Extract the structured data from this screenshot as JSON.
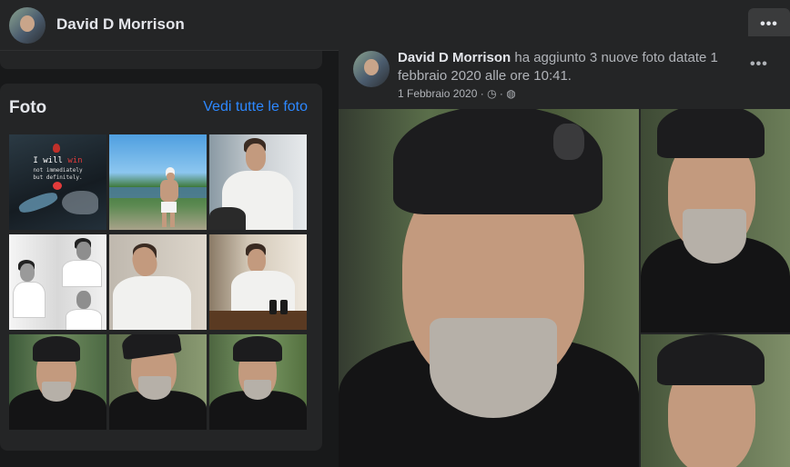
{
  "header": {
    "name": "David D Morrison",
    "more_label": "•••"
  },
  "photos": {
    "title": "Foto",
    "see_all": "Vedi tutte le foto",
    "quote_line1": "I will ",
    "quote_win": "win",
    "quote_line2": "not immediately",
    "quote_line3": "but definitely."
  },
  "post": {
    "author": "David D Morrison",
    "action": " ha aggiunto 3 nuove foto datate 1 febbraio 2020 alle ore 10:41.",
    "date": "1 Febbraio 2020",
    "meta_separator": " · ",
    "more_label": "•••"
  },
  "colors": {
    "background": "#18191a",
    "card": "#242526",
    "link": "#2d88ff",
    "text": "#e4e6eb",
    "secondary": "#b0b3b8"
  }
}
